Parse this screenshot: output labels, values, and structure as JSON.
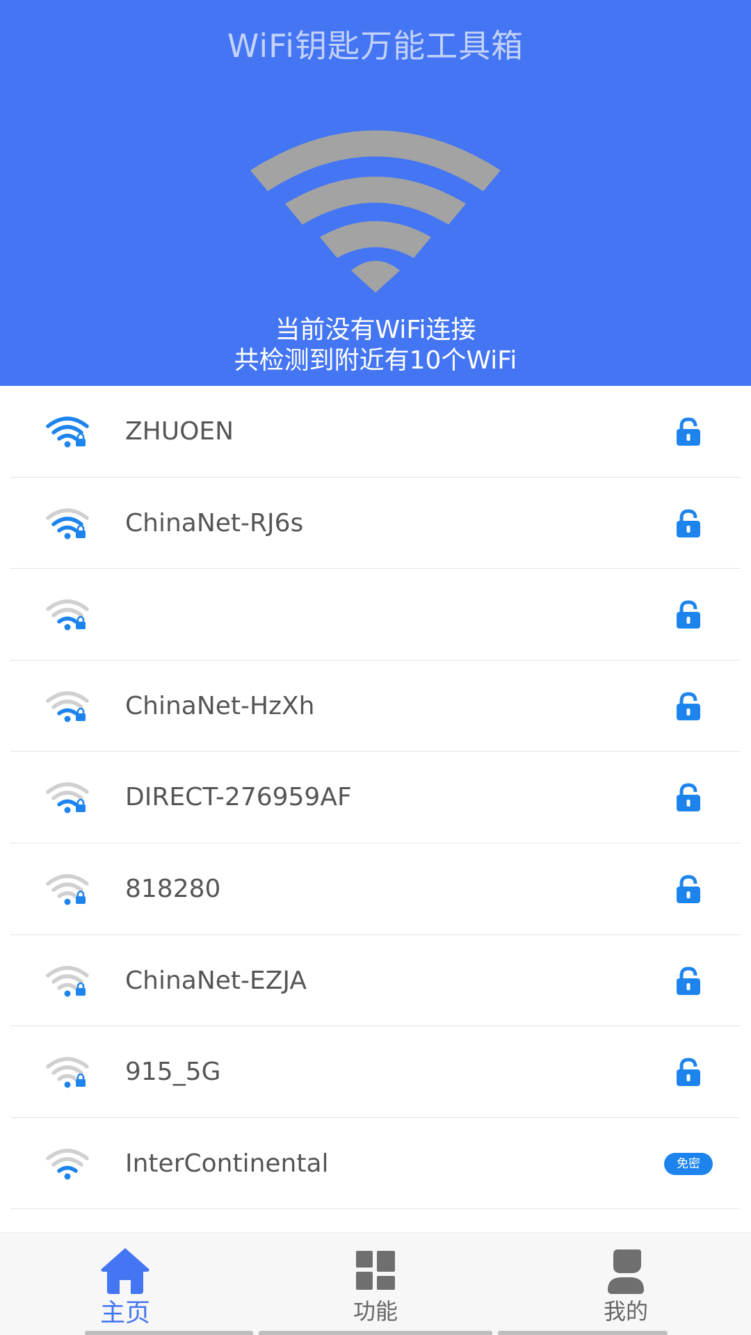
{
  "app": {
    "title": "WiFi钥匙万能工具箱"
  },
  "status": {
    "line1": "当前没有WiFi连接",
    "line2": "共检测到附近有10个WiFi"
  },
  "colors": {
    "header_bg": "#4475f2",
    "accent": "#1d84ee",
    "hero_icon": "#a3a3a3",
    "signal_inactive": "#d0d0d0"
  },
  "wifi_list": [
    {
      "name": "ZHUOEN",
      "signal_bars": 3,
      "secured": true,
      "icon": "lock-icon"
    },
    {
      "name": "ChinaNet-RJ6s",
      "signal_bars": 2,
      "secured": true,
      "icon": "lock-icon"
    },
    {
      "name": "",
      "signal_bars": 1,
      "secured": true,
      "icon": "lock-icon"
    },
    {
      "name": "ChinaNet-HzXh",
      "signal_bars": 1,
      "secured": true,
      "icon": "lock-icon"
    },
    {
      "name": "DIRECT-276959AF",
      "signal_bars": 1,
      "secured": true,
      "icon": "lock-icon"
    },
    {
      "name": "818280",
      "signal_bars": 0,
      "secured": true,
      "icon": "lock-icon"
    },
    {
      "name": "ChinaNet-EZJA",
      "signal_bars": 0,
      "secured": true,
      "icon": "lock-icon"
    },
    {
      "name": "915_5G",
      "signal_bars": 0,
      "secured": true,
      "icon": "lock-icon"
    },
    {
      "name": "InterContinental",
      "signal_bars": 1,
      "secured": false,
      "badge": "免密"
    }
  ],
  "nav": {
    "home": {
      "label": "主页",
      "icon": "home-icon",
      "active": true
    },
    "functions": {
      "label": "功能",
      "icon": "grid-icon",
      "active": false
    },
    "mine": {
      "label": "我的",
      "icon": "user-icon",
      "active": false
    }
  }
}
